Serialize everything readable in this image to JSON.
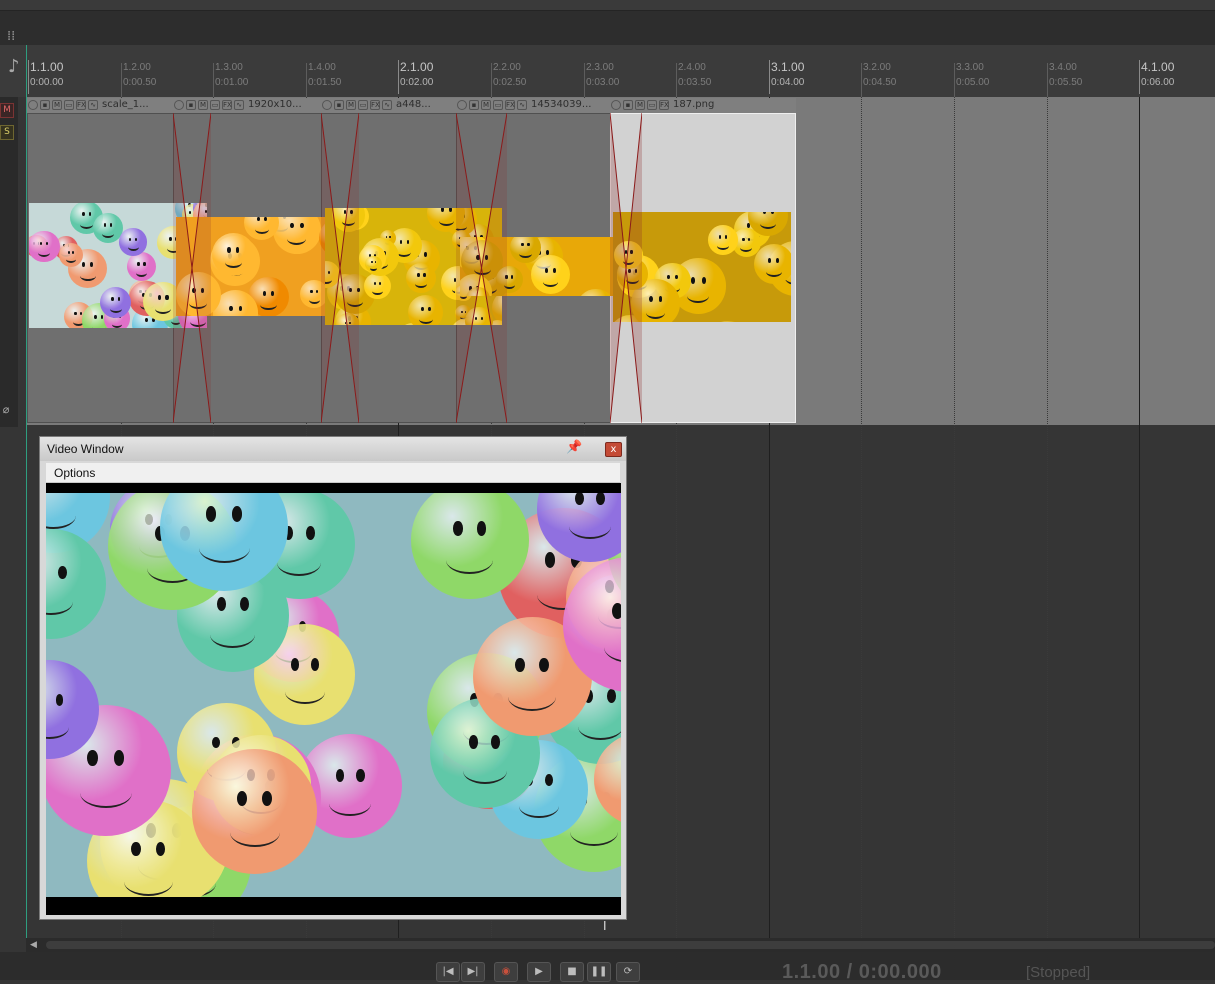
{
  "ruler": {
    "marks": [
      {
        "bar": "1.1.00",
        "time": "0:00.00",
        "major": true
      },
      {
        "bar": "1.2.00",
        "time": "0:00.50",
        "major": false
      },
      {
        "bar": "1.3.00",
        "time": "0:01.00",
        "major": false
      },
      {
        "bar": "1.4.00",
        "time": "0:01.50",
        "major": false
      },
      {
        "bar": "2.1.00",
        "time": "0:02.00",
        "major": true
      },
      {
        "bar": "2.2.00",
        "time": "0:02.50",
        "major": false
      },
      {
        "bar": "2.3.00",
        "time": "0:03.00",
        "major": false
      },
      {
        "bar": "2.4.00",
        "time": "0:03.50",
        "major": false
      },
      {
        "bar": "3.1.00",
        "time": "0:04.00",
        "major": true
      },
      {
        "bar": "3.2.00",
        "time": "0:04.50",
        "major": false
      },
      {
        "bar": "3.3.00",
        "time": "0:05.00",
        "major": false
      },
      {
        "bar": "3.4.00",
        "time": "0:05.50",
        "major": false
      },
      {
        "bar": "4.1.00",
        "time": "0:06.00",
        "major": true
      }
    ]
  },
  "tcp": {
    "mute_label": "M",
    "solo_label": "S"
  },
  "items": [
    {
      "title": "scale_1...",
      "selected": false
    },
    {
      "title": "1920x10...",
      "selected": false
    },
    {
      "title": "a448...",
      "selected": false
    },
    {
      "title": "14534039...",
      "selected": false
    },
    {
      "title": "187.png",
      "selected": true
    }
  ],
  "item_header_icons": [
    "O",
    "lock",
    "M",
    "speech",
    "FX",
    "env"
  ],
  "video_window": {
    "title": "Video Window",
    "menu_options": "Options",
    "close_label": "x"
  },
  "transport": {
    "time": "1.1.00 / 0:00.000",
    "status": "[Stopped]"
  },
  "colors": {
    "background": "#353535",
    "track_lane": "#7a7a7a",
    "selected_item": "#d2d2d2",
    "crossfade": "#8b1a1a",
    "close_button": "#c44b36"
  }
}
